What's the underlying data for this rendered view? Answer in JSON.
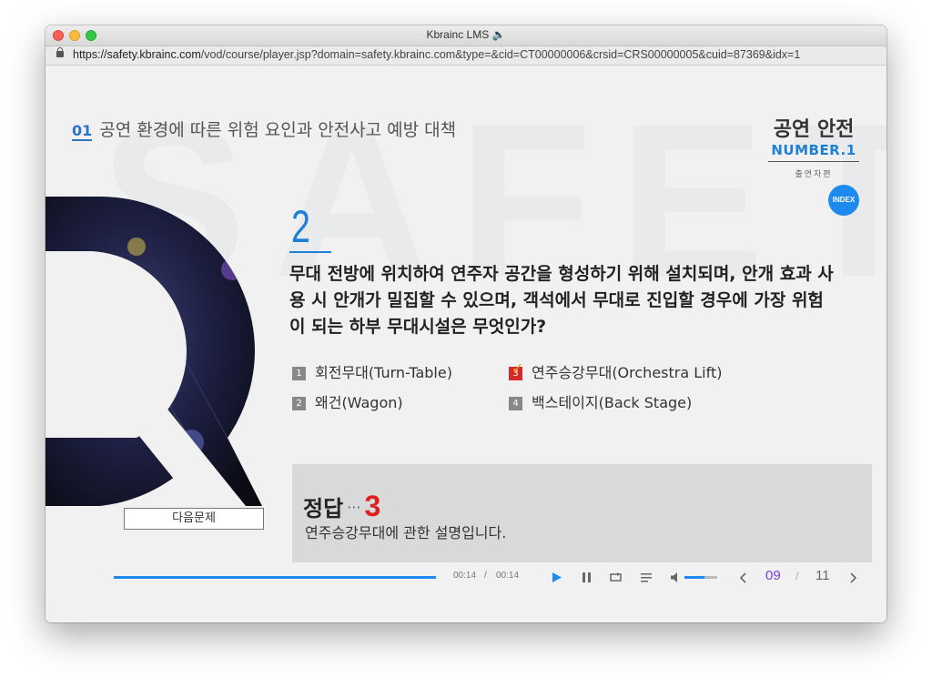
{
  "window": {
    "title": "Kbrainc LMS 🔈"
  },
  "browser": {
    "url_domain": "https://safety.kbrainc.com",
    "url_path": "/vod/course/player.jsp?domain=safety.kbrainc.com&type=&cid=CT00000006&crsid=CRS00000005&cuid=87369&idx=1"
  },
  "course": {
    "section_number": "01",
    "section_title": "공연 환경에 따른 위험 요인과 안전사고 예방 대책",
    "brand_title": "공연 안전",
    "brand_subtitle": "NUMBER.1",
    "brand_caption": "출연자편",
    "index_label": "INDEX"
  },
  "quiz": {
    "question_number": "2",
    "question_text": "무대 전방에 위치하여 연주자 공간을 형성하기 위해 설치되며, 안개 효과 사용 시 안개가 밀집할 수 있으며, 객석에서 무대로 진입할 경우에 가장 위험이 되는 하부 무대시설은 무엇인가?",
    "options": [
      {
        "num": "1",
        "label": "회전무대(Turn-Table)"
      },
      {
        "num": "2",
        "label": "왜건(Wagon)"
      },
      {
        "num": "3",
        "label": "연주승강무대(Orchestra Lift)",
        "selected": true
      },
      {
        "num": "4",
        "label": "백스테이지(Back Stage)"
      }
    ],
    "answer_label": "정답",
    "answer_dots": "···",
    "answer_value": "3",
    "answer_description": "연주승강무대에 관한 설명입니다.",
    "next_button": "다음문제"
  },
  "player": {
    "progress": 1.0,
    "current_time": "00:14",
    "separator": "/",
    "total_time": "00:14",
    "volume": 0.6,
    "current_page": "09",
    "page_separator": "/",
    "total_pages": "11",
    "colors": {
      "accent": "#1e8af0",
      "page": "#7a3fd6"
    }
  }
}
